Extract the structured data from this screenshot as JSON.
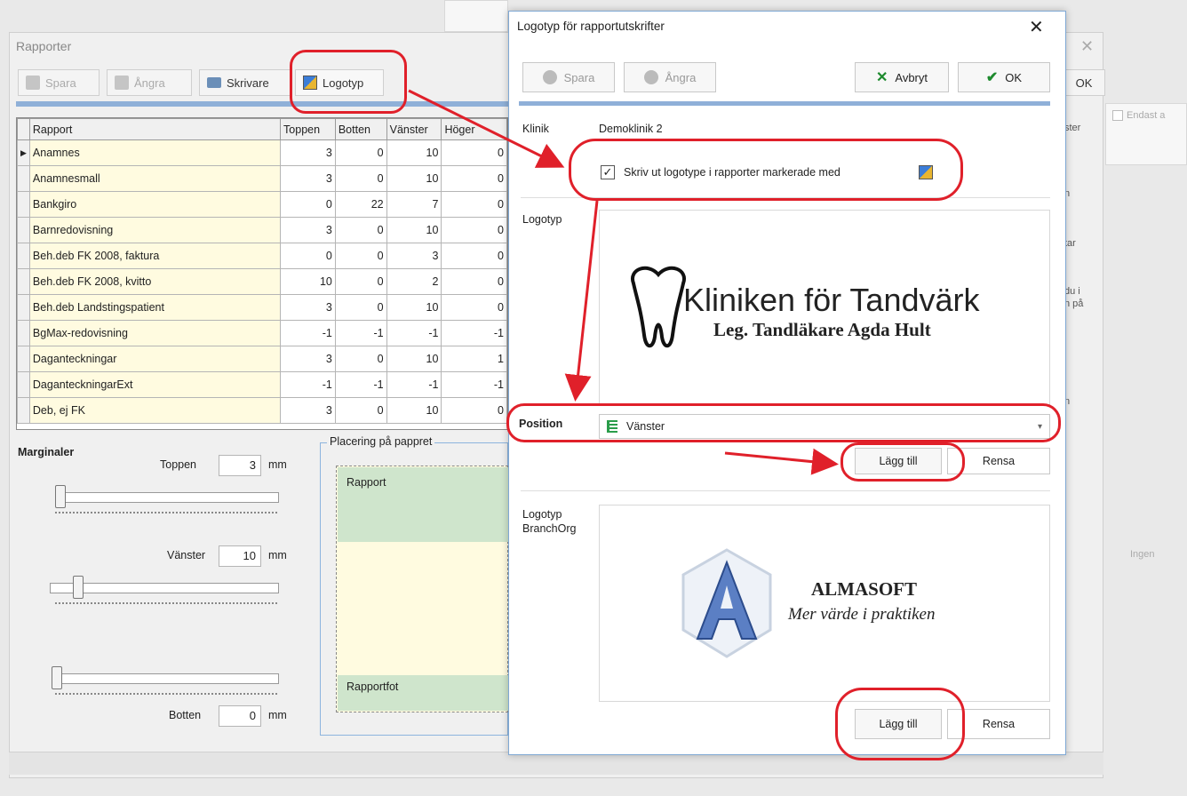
{
  "background_window": {
    "title": "Rapporter",
    "close": "✕",
    "toolbar": [
      {
        "label": "Spara",
        "icon": "save-icon",
        "disabled": true
      },
      {
        "label": "Ångra",
        "icon": "undo-icon",
        "disabled": true
      },
      {
        "label": "Skrivare",
        "icon": "printer-icon",
        "disabled": false
      },
      {
        "label": "Logotyp",
        "icon": "logo-icon",
        "disabled": false
      }
    ],
    "ok_label": "OK",
    "grid": {
      "headers": [
        "Rapport",
        "Toppen",
        "Botten",
        "Vänster",
        "Höger"
      ],
      "rows": [
        [
          "Anamnes",
          "3",
          "0",
          "10",
          "0"
        ],
        [
          "Anamnesmall",
          "3",
          "0",
          "10",
          "0"
        ],
        [
          "Bankgiro",
          "0",
          "22",
          "7",
          "0"
        ],
        [
          "Barnredovisning",
          "3",
          "0",
          "10",
          "0"
        ],
        [
          "Beh.deb FK 2008, faktura",
          "0",
          "0",
          "3",
          "0"
        ],
        [
          "Beh.deb FK 2008, kvitto",
          "10",
          "0",
          "2",
          "0"
        ],
        [
          "Beh.deb Landstingspatient",
          "3",
          "0",
          "10",
          "0"
        ],
        [
          "BgMax-redovisning",
          "-1",
          "-1",
          "-1",
          "-1"
        ],
        [
          "Daganteckningar",
          "3",
          "0",
          "10",
          "1"
        ],
        [
          "DaganteckningarExt",
          "-1",
          "-1",
          "-1",
          "-1"
        ],
        [
          "Deb, ej FK",
          "3",
          "0",
          "10",
          "0"
        ]
      ]
    },
    "margins": {
      "heading": "Marginaler",
      "top_label": "Toppen",
      "top_value": "3",
      "top_unit": "mm",
      "left_label": "Vänster",
      "left_value": "10",
      "left_unit": "mm",
      "bottom_label": "Botten",
      "bottom_value": "0",
      "bottom_unit": "mm"
    },
    "placement": {
      "label": "Placering på pappret",
      "header": "Rapport",
      "footer": "Rapportfot"
    },
    "right_fragments": [
      "Endast a",
      "ster",
      "n",
      "tar",
      "du i",
      "n på",
      "n",
      "Ingen"
    ]
  },
  "dialog": {
    "title": "Logotyp för rapportutskrifter",
    "close": "✕",
    "buttons": {
      "save": "Spara",
      "undo": "Ångra",
      "cancel": "Avbryt",
      "ok": "OK"
    },
    "clinic_label": "Klinik",
    "clinic_value": "Demoklinik 2",
    "checkbox_label": "Skriv ut logotype i rapporter markerade med",
    "checkbox_checked": true,
    "logo_label": "Logotyp",
    "logo_text_main": "Kliniken för Tandvärk",
    "logo_text_sub": "Leg. Tandläkare Agda Hult",
    "position_label": "Position",
    "position_value": "Vänster",
    "add_label": "Lägg till",
    "clear_label": "Rensa",
    "branch_label_line1": "Logotyp",
    "branch_label_line2": "BranchOrg",
    "branch_logo_name": "ALMASOFT",
    "branch_logo_tagline": "Mer värde i praktiken",
    "add_label_2": "Lägg till",
    "clear_label_2": "Rensa"
  },
  "colors": {
    "highlight_red": "#e0202a",
    "accent_blue": "#8fb0d8",
    "name_cell": "#fffbe0",
    "band_green": "#cfe5cc"
  }
}
